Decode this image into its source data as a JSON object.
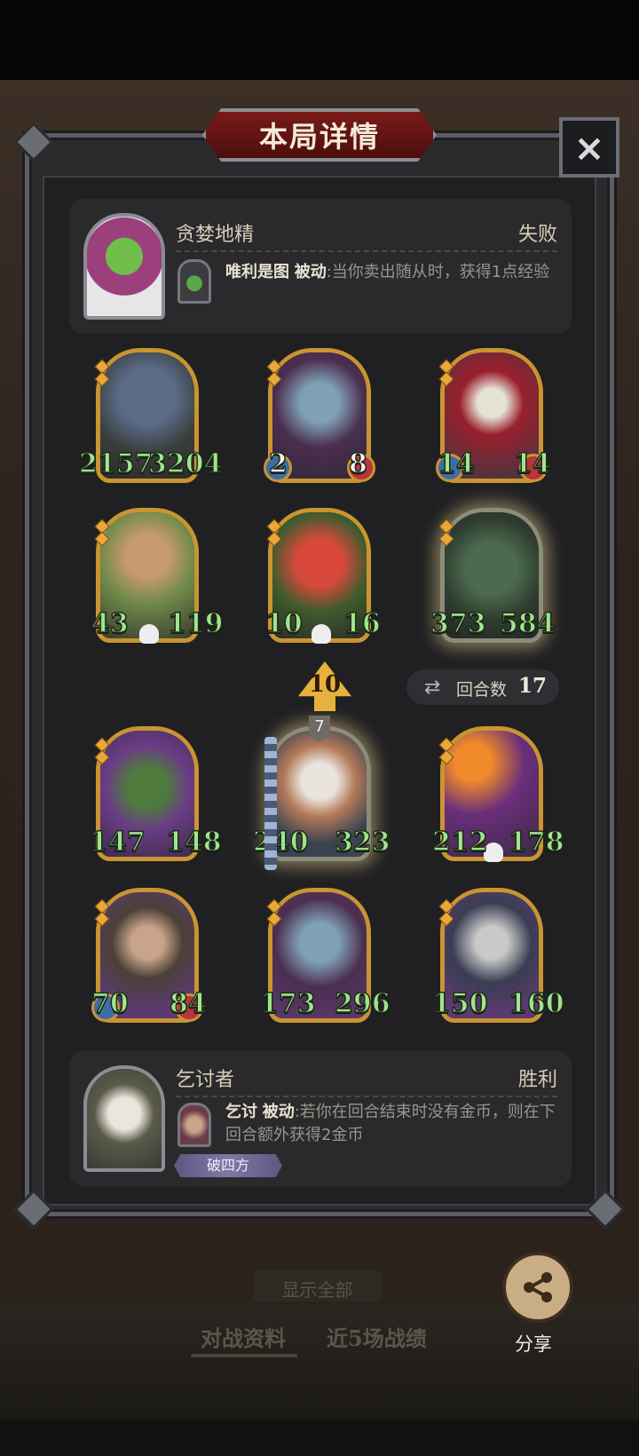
{
  "dialog": {
    "title": "本局详情",
    "close_icon": "×"
  },
  "top_player": {
    "name": "贪婪地精",
    "result": "失败",
    "skill_name": "唯利是图",
    "skill_type": "被动",
    "skill_desc": ":当你卖出随从时，获得1点经验"
  },
  "board": {
    "rows": [
      [
        {
          "attack": "2157",
          "health": "3204"
        },
        {
          "attack": "2",
          "health": "8"
        },
        {
          "attack": "14",
          "health": "14"
        }
      ],
      [
        {
          "attack": "43",
          "health": "119"
        },
        {
          "attack": "10",
          "health": "16"
        },
        {
          "attack": "373",
          "health": "584"
        }
      ],
      [
        {
          "attack": "147",
          "health": "148"
        },
        {
          "attack": "240",
          "health": "323"
        },
        {
          "attack": "212",
          "health": "178"
        }
      ],
      [
        {
          "attack": "70",
          "health": "84"
        },
        {
          "attack": "173",
          "health": "296"
        },
        {
          "attack": "150",
          "health": "160"
        }
      ]
    ],
    "golden_card_level": "7"
  },
  "turn_info": {
    "level": "10",
    "turns_label": "回合数",
    "turns_value": "17"
  },
  "bottom_player": {
    "name": "乞讨者",
    "result": "胜利",
    "skill_name": "乞讨",
    "skill_type": "被动",
    "skill_desc": ":若你在回合结束时没有金币，则在下回合额外获得2金币",
    "tag": "破四方"
  },
  "bottom_nav": {
    "show_all": "显示全部",
    "tab_battle_info": "对战资料",
    "tab_recent": "近5场战绩"
  },
  "share": {
    "label": "分享"
  }
}
